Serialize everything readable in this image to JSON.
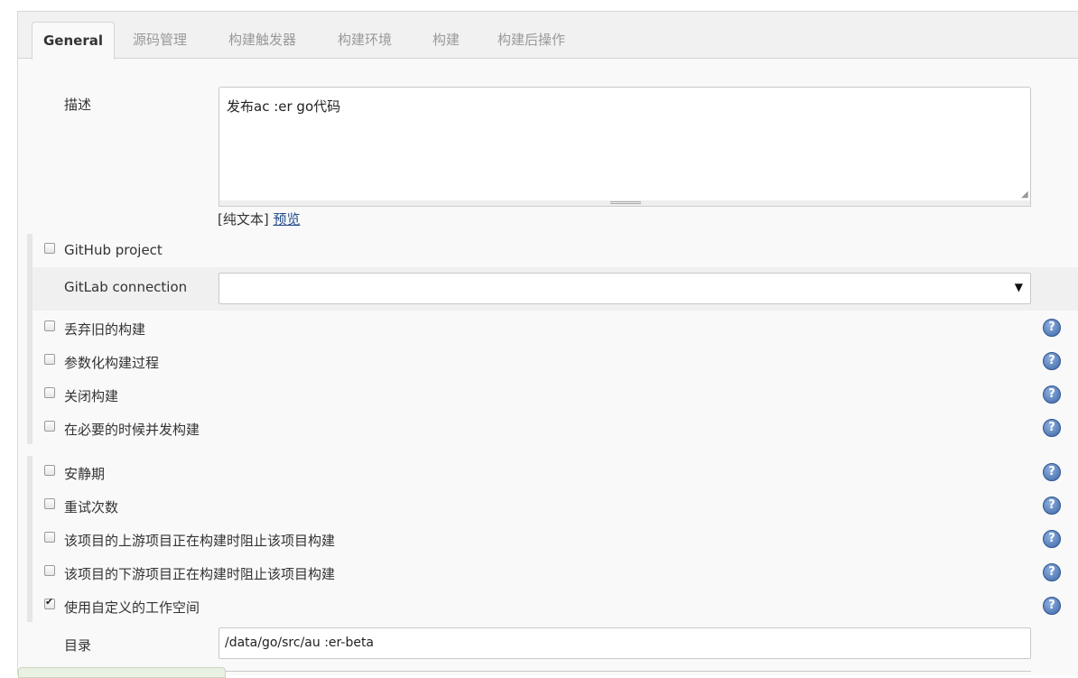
{
  "tabs": [
    {
      "label": "General",
      "active": true
    },
    {
      "label": "源码管理"
    },
    {
      "label": "构建触发器"
    },
    {
      "label": "构建环境"
    },
    {
      "label": "构建"
    },
    {
      "label": "构建后操作"
    }
  ],
  "description": {
    "label": "描述",
    "value": "发布ac      :er go代码",
    "format_plain": "[纯文本]",
    "format_preview": "预览"
  },
  "github_project": {
    "label": "GitHub project",
    "checked": false
  },
  "gitlab_connection": {
    "label": "GitLab connection",
    "value": "",
    "caret": "▼"
  },
  "options_group1": [
    {
      "label": "丢弃旧的构建",
      "checked": false
    },
    {
      "label": "参数化构建过程",
      "checked": false
    },
    {
      "label": "关闭构建",
      "checked": false
    },
    {
      "label": "在必要的时候并发构建",
      "checked": false
    }
  ],
  "options_group2": [
    {
      "label": "安静期",
      "checked": false
    },
    {
      "label": "重试次数",
      "checked": false
    },
    {
      "label": "该项目的上游项目正在构建时阻止该项目构建",
      "checked": false
    },
    {
      "label": "该项目的下游项目正在构建时阻止该项目构建",
      "checked": false
    },
    {
      "label": "使用自定义的工作空间",
      "checked": true
    }
  ],
  "directory": {
    "label": "目录",
    "value": "/data/go/src/au      :er-beta"
  },
  "help_icon_glyph": "?",
  "colors": {
    "link": "#204a87",
    "help_icon": "#3c66a8",
    "tab_inactive": "#999999"
  }
}
